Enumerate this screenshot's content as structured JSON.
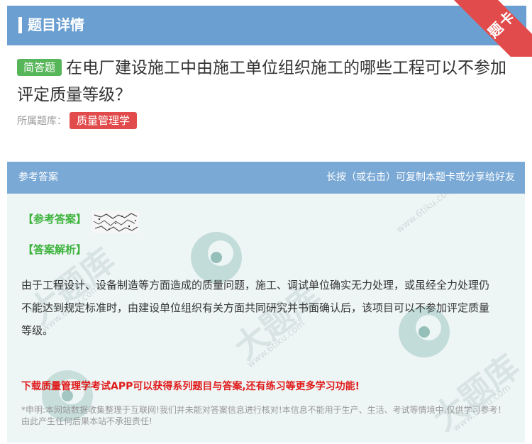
{
  "header": {
    "title": "题目详情",
    "ribbon_label": "题卡"
  },
  "question": {
    "type_label": "简答题",
    "text": "在电厂建设施工中由施工单位组织施工的哪些工程可以不参加评定质量等级？",
    "bank_label": "所属题库：",
    "bank_name": "质量管理学"
  },
  "answer_card": {
    "header_left": "参考答案",
    "header_right": "长按（或右击）可复制本题卡或分享给好友",
    "answer_label": "【参考答案】",
    "analysis_label": "【答案解析】",
    "analysis_text": "由于工程设计、设备制造等方面造成的质量问题，施工、调试单位确实无力处理，或虽经全力处理仍不能达到规定标准时，由建设单位组织有关方面共同研究并书面确认后，该项目可以不参加评定质量等级。",
    "promo_text": "下载质量管理学考试APP可以获得系列题目与答案,还有练习等更多学习功能!",
    "disclaimer_text": "*申明:本网站数据收集整理于互联网!我们并未能对答案信息进行核对!本信息不能用于生产、生活、考试等情境中,仅供学习参考！由此产生任何后果本站不承担责任!"
  },
  "watermark": {
    "brand": "大题库",
    "domain": "www.6tiku.com"
  },
  "colors": {
    "header_bg": "#6b9fd1",
    "card_header_bg": "#7aa9d6",
    "tag_green": "#58b65a",
    "tag_red": "#e24b4b",
    "promo_red": "#e01b1b"
  }
}
